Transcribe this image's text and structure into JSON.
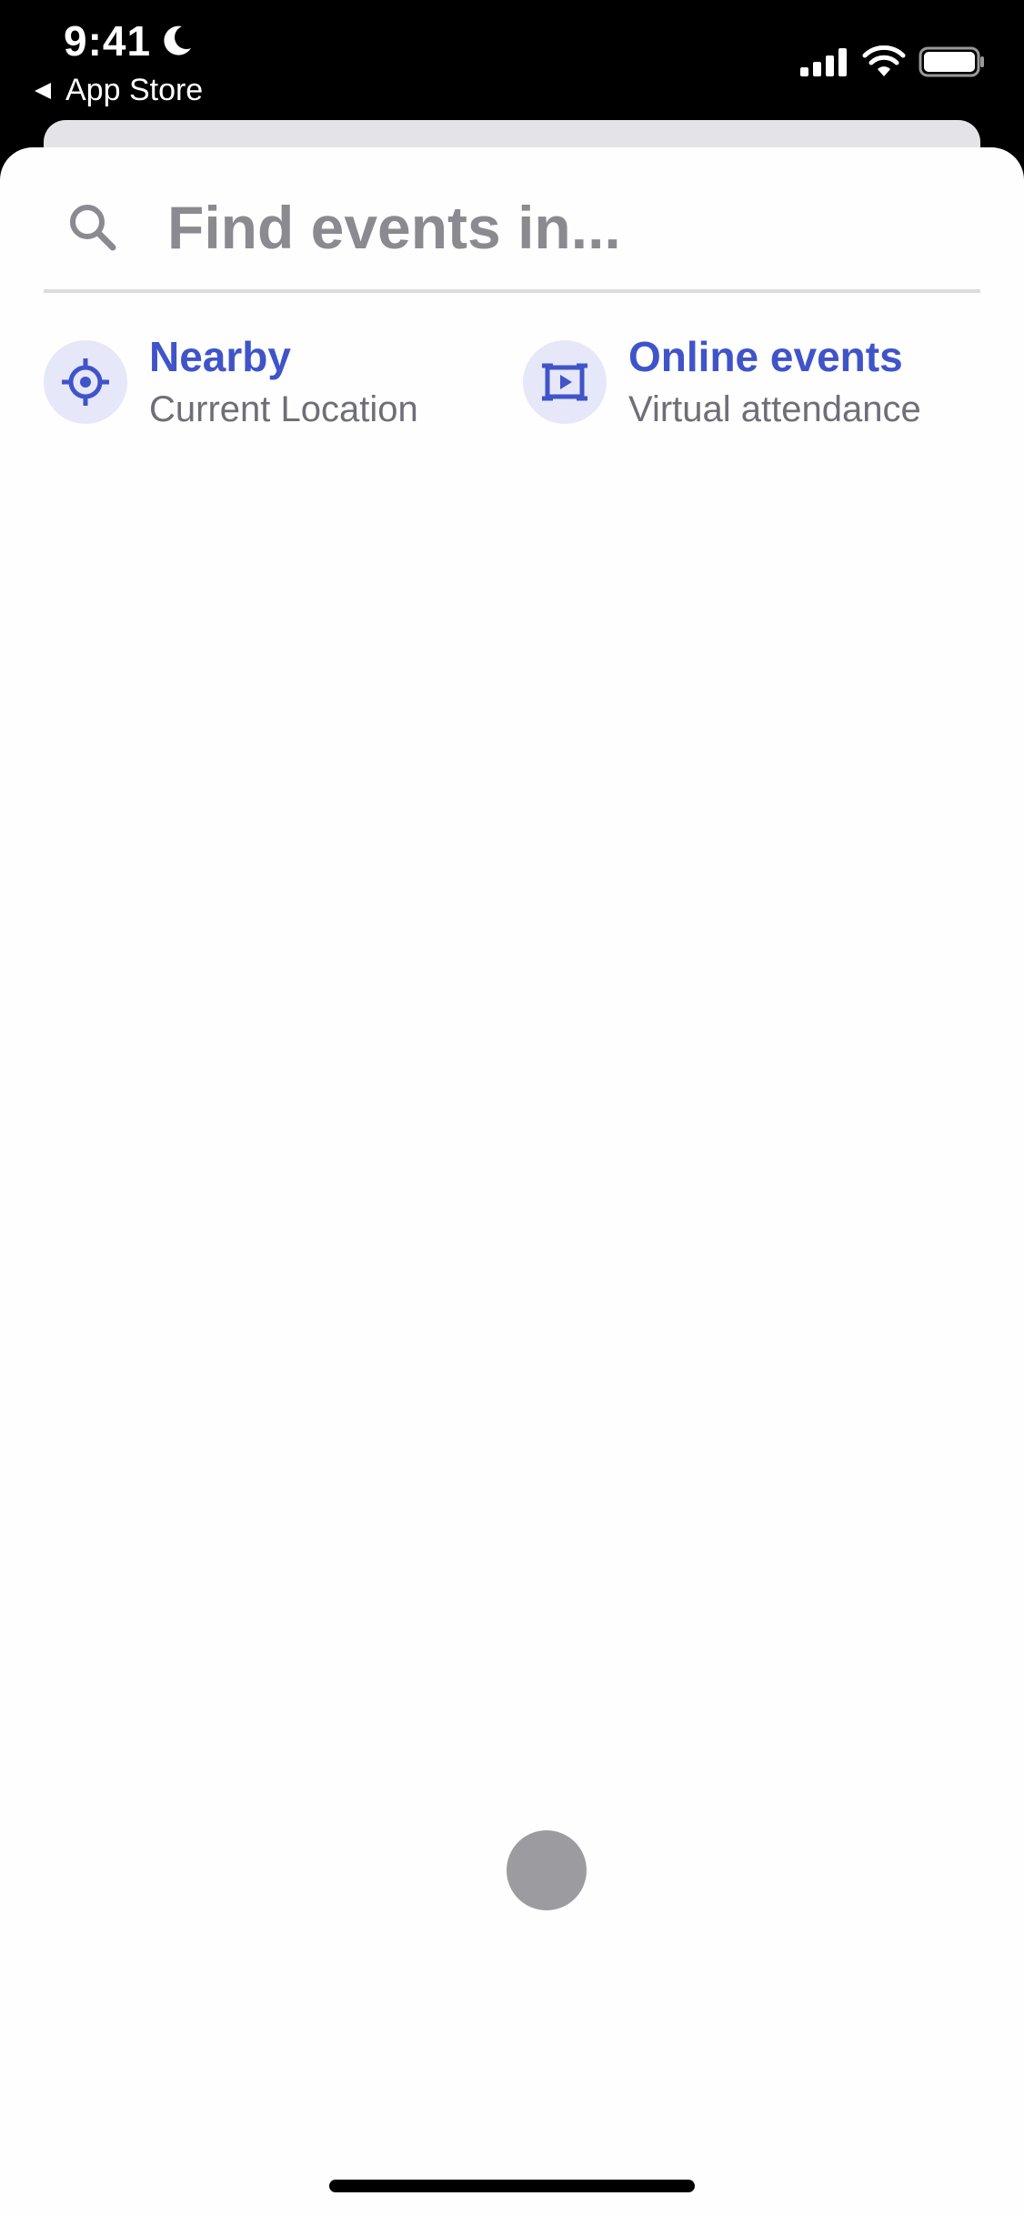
{
  "status_bar": {
    "time": "9:41",
    "back_label": "App Store",
    "icons": [
      "moon-icon",
      "signal-icon",
      "wifi-icon",
      "battery-icon"
    ]
  },
  "search": {
    "placeholder": "Find events in...",
    "value": "",
    "icon": "search-icon"
  },
  "options": [
    {
      "title": "Nearby",
      "subtitle": "Current Location",
      "icon": "crosshair-icon"
    },
    {
      "title": "Online events",
      "subtitle": "Virtual attendance",
      "icon": "video-frame-icon"
    }
  ],
  "colors": {
    "accent": "#4054c9",
    "icon_bg": "#e6e8f9",
    "placeholder": "#8b8a90",
    "subtitle": "#6f6e78",
    "divider": "#dcdbe2",
    "loading": "#9c9ba0"
  }
}
